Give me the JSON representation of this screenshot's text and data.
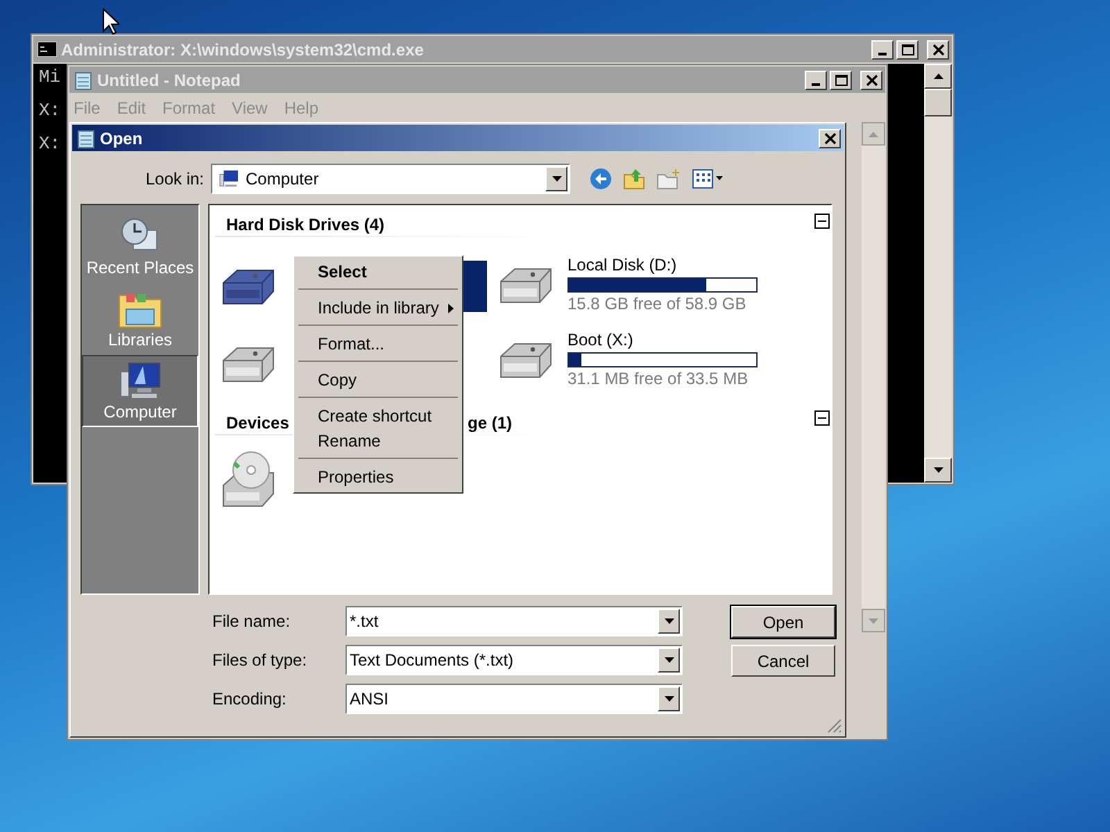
{
  "cmd_window": {
    "title": "Administrator: X:\\windows\\system32\\cmd.exe",
    "console_lines": [
      "Mi",
      "X:",
      "X:"
    ]
  },
  "notepad": {
    "title": "Untitled - Notepad",
    "menu": [
      "File",
      "Edit",
      "Format",
      "View",
      "Help"
    ]
  },
  "open_dialog": {
    "title": "Open",
    "look_in": {
      "label": "Look in:",
      "value": "Computer"
    },
    "places": [
      {
        "label": "Recent Places",
        "kind": "recent",
        "selected": false
      },
      {
        "label": "Libraries",
        "kind": "libraries",
        "selected": false
      },
      {
        "label": "Computer",
        "kind": "computer",
        "selected": true
      }
    ],
    "hard_disk_group": {
      "header": "Hard Disk Drives (4)",
      "expanded": true,
      "covered_drives": [
        {
          "selected": true
        },
        {
          "selected": false
        }
      ],
      "drives": [
        {
          "name": "Local Disk (D:)",
          "level": 0.73,
          "free": "15.8 GB free of 58.9 GB"
        },
        {
          "name": "Boot (X:)",
          "level": 0.07,
          "free": "31.1 MB free of 33.5 MB"
        }
      ]
    },
    "devices_group": {
      "header_parts": [
        "Devices",
        "ge (1)"
      ],
      "expanded": true
    },
    "context_menu": [
      {
        "kind": "default",
        "label": "Select"
      },
      {
        "kind": "separator"
      },
      {
        "kind": "submenu",
        "label": "Include in library"
      },
      {
        "kind": "separator"
      },
      {
        "kind": "item",
        "label": "Format..."
      },
      {
        "kind": "separator"
      },
      {
        "kind": "item",
        "label": "Copy"
      },
      {
        "kind": "separator"
      },
      {
        "kind": "item",
        "label": "Create shortcut"
      },
      {
        "kind": "item",
        "label": "Rename"
      },
      {
        "kind": "separator"
      },
      {
        "kind": "item",
        "label": "Properties"
      }
    ],
    "fields": [
      {
        "label": "File name:",
        "value": "*.txt"
      },
      {
        "label": "Files of type:",
        "value": "Text Documents (*.txt)"
      },
      {
        "label": "Encoding:",
        "value": "ANSI"
      }
    ],
    "buttons": [
      {
        "label": "Open",
        "default": true
      },
      {
        "label": "Cancel",
        "default": false
      }
    ]
  }
}
